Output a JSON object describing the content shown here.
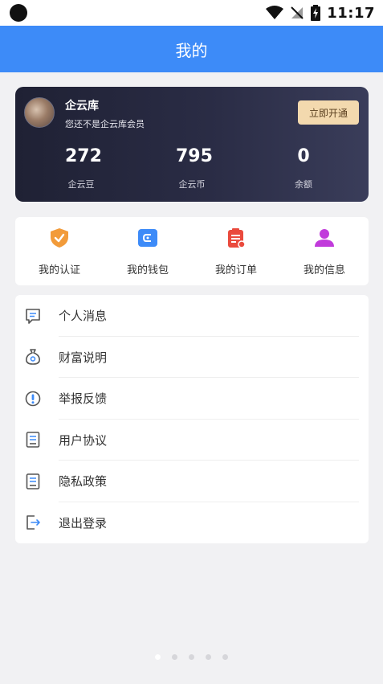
{
  "status_bar": {
    "time": "11:17"
  },
  "header": {
    "title": "我的"
  },
  "member_card": {
    "name": "企云库",
    "subtitle": "您还不是企云库会员",
    "open_button": "立即开通",
    "stats": [
      {
        "value": "272",
        "label": "企云豆"
      },
      {
        "value": "795",
        "label": "企云币"
      },
      {
        "value": "0",
        "label": "余额"
      }
    ]
  },
  "shortcuts": [
    {
      "label": "我的认证",
      "icon": "shield-check-icon",
      "color": "#f29b3a"
    },
    {
      "label": "我的钱包",
      "icon": "wallet-icon",
      "color": "#3d8bf8"
    },
    {
      "label": "我的订单",
      "icon": "clipboard-icon",
      "color": "#ea4a3d"
    },
    {
      "label": "我的信息",
      "icon": "person-icon",
      "color": "#c13bdb"
    }
  ],
  "menu": [
    {
      "label": "个人消息",
      "icon": "message-icon"
    },
    {
      "label": "财富说明",
      "icon": "money-bag-icon"
    },
    {
      "label": "举报反馈",
      "icon": "alert-icon"
    },
    {
      "label": "用户协议",
      "icon": "document-icon"
    },
    {
      "label": "隐私政策",
      "icon": "document-icon"
    },
    {
      "label": "退出登录",
      "icon": "logout-icon"
    }
  ],
  "colors": {
    "accent": "#3d8bf8",
    "card_dark": "#1f2134",
    "button_gold": "#f3d9ae"
  },
  "pager": {
    "pages": 5,
    "active": 1
  }
}
